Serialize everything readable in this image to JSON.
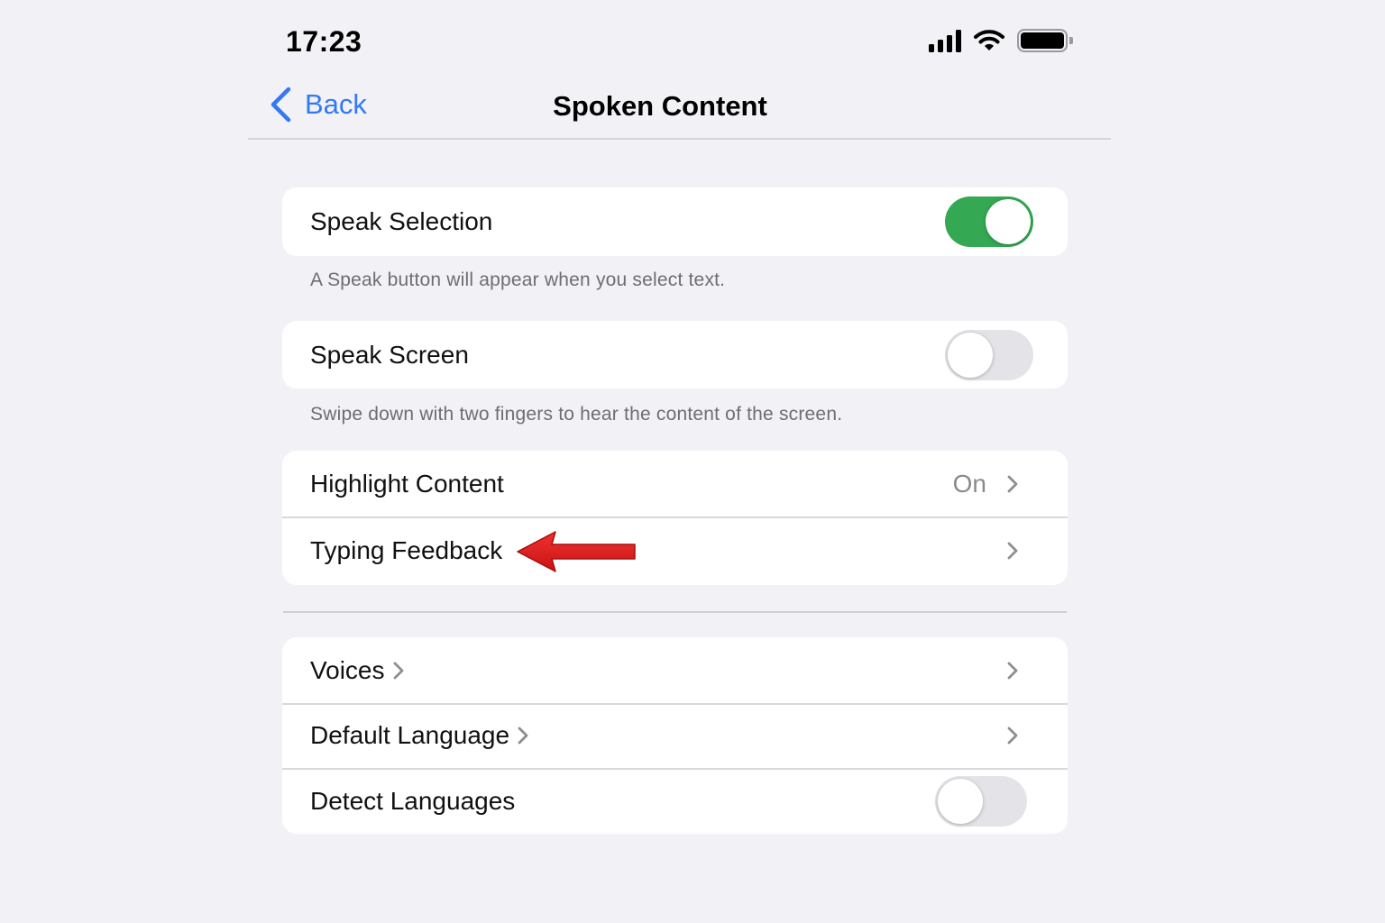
{
  "status_bar": {
    "time": "17:23"
  },
  "nav": {
    "back_label": "Back",
    "title": "Spoken Content"
  },
  "speak_selection": {
    "label": "Speak Selection",
    "enabled": true,
    "footnote": "A Speak button will appear when you select text."
  },
  "speak_screen": {
    "label": "Speak Screen",
    "enabled": false,
    "footnote": "Swipe down with two fingers to hear the content of the screen."
  },
  "content_group": {
    "highlight_label": "Highlight Content",
    "highlight_value": "On",
    "typing_feedback_label": "Typing Feedback"
  },
  "language_group": {
    "voices_label": "Voices",
    "default_language_label": "Default Language",
    "detect_languages_label": "Detect Languages",
    "detect_languages_enabled": false
  },
  "colors": {
    "accent": "#3478f6",
    "toggle_on": "#34a853",
    "annotation_arrow": "#e02020",
    "background": "#f2f2f6"
  },
  "icons": [
    "back-chevron-icon",
    "signal-icon",
    "wifi-icon",
    "battery-icon",
    "chevron-right-icon",
    "red-arrow-annotation"
  ]
}
